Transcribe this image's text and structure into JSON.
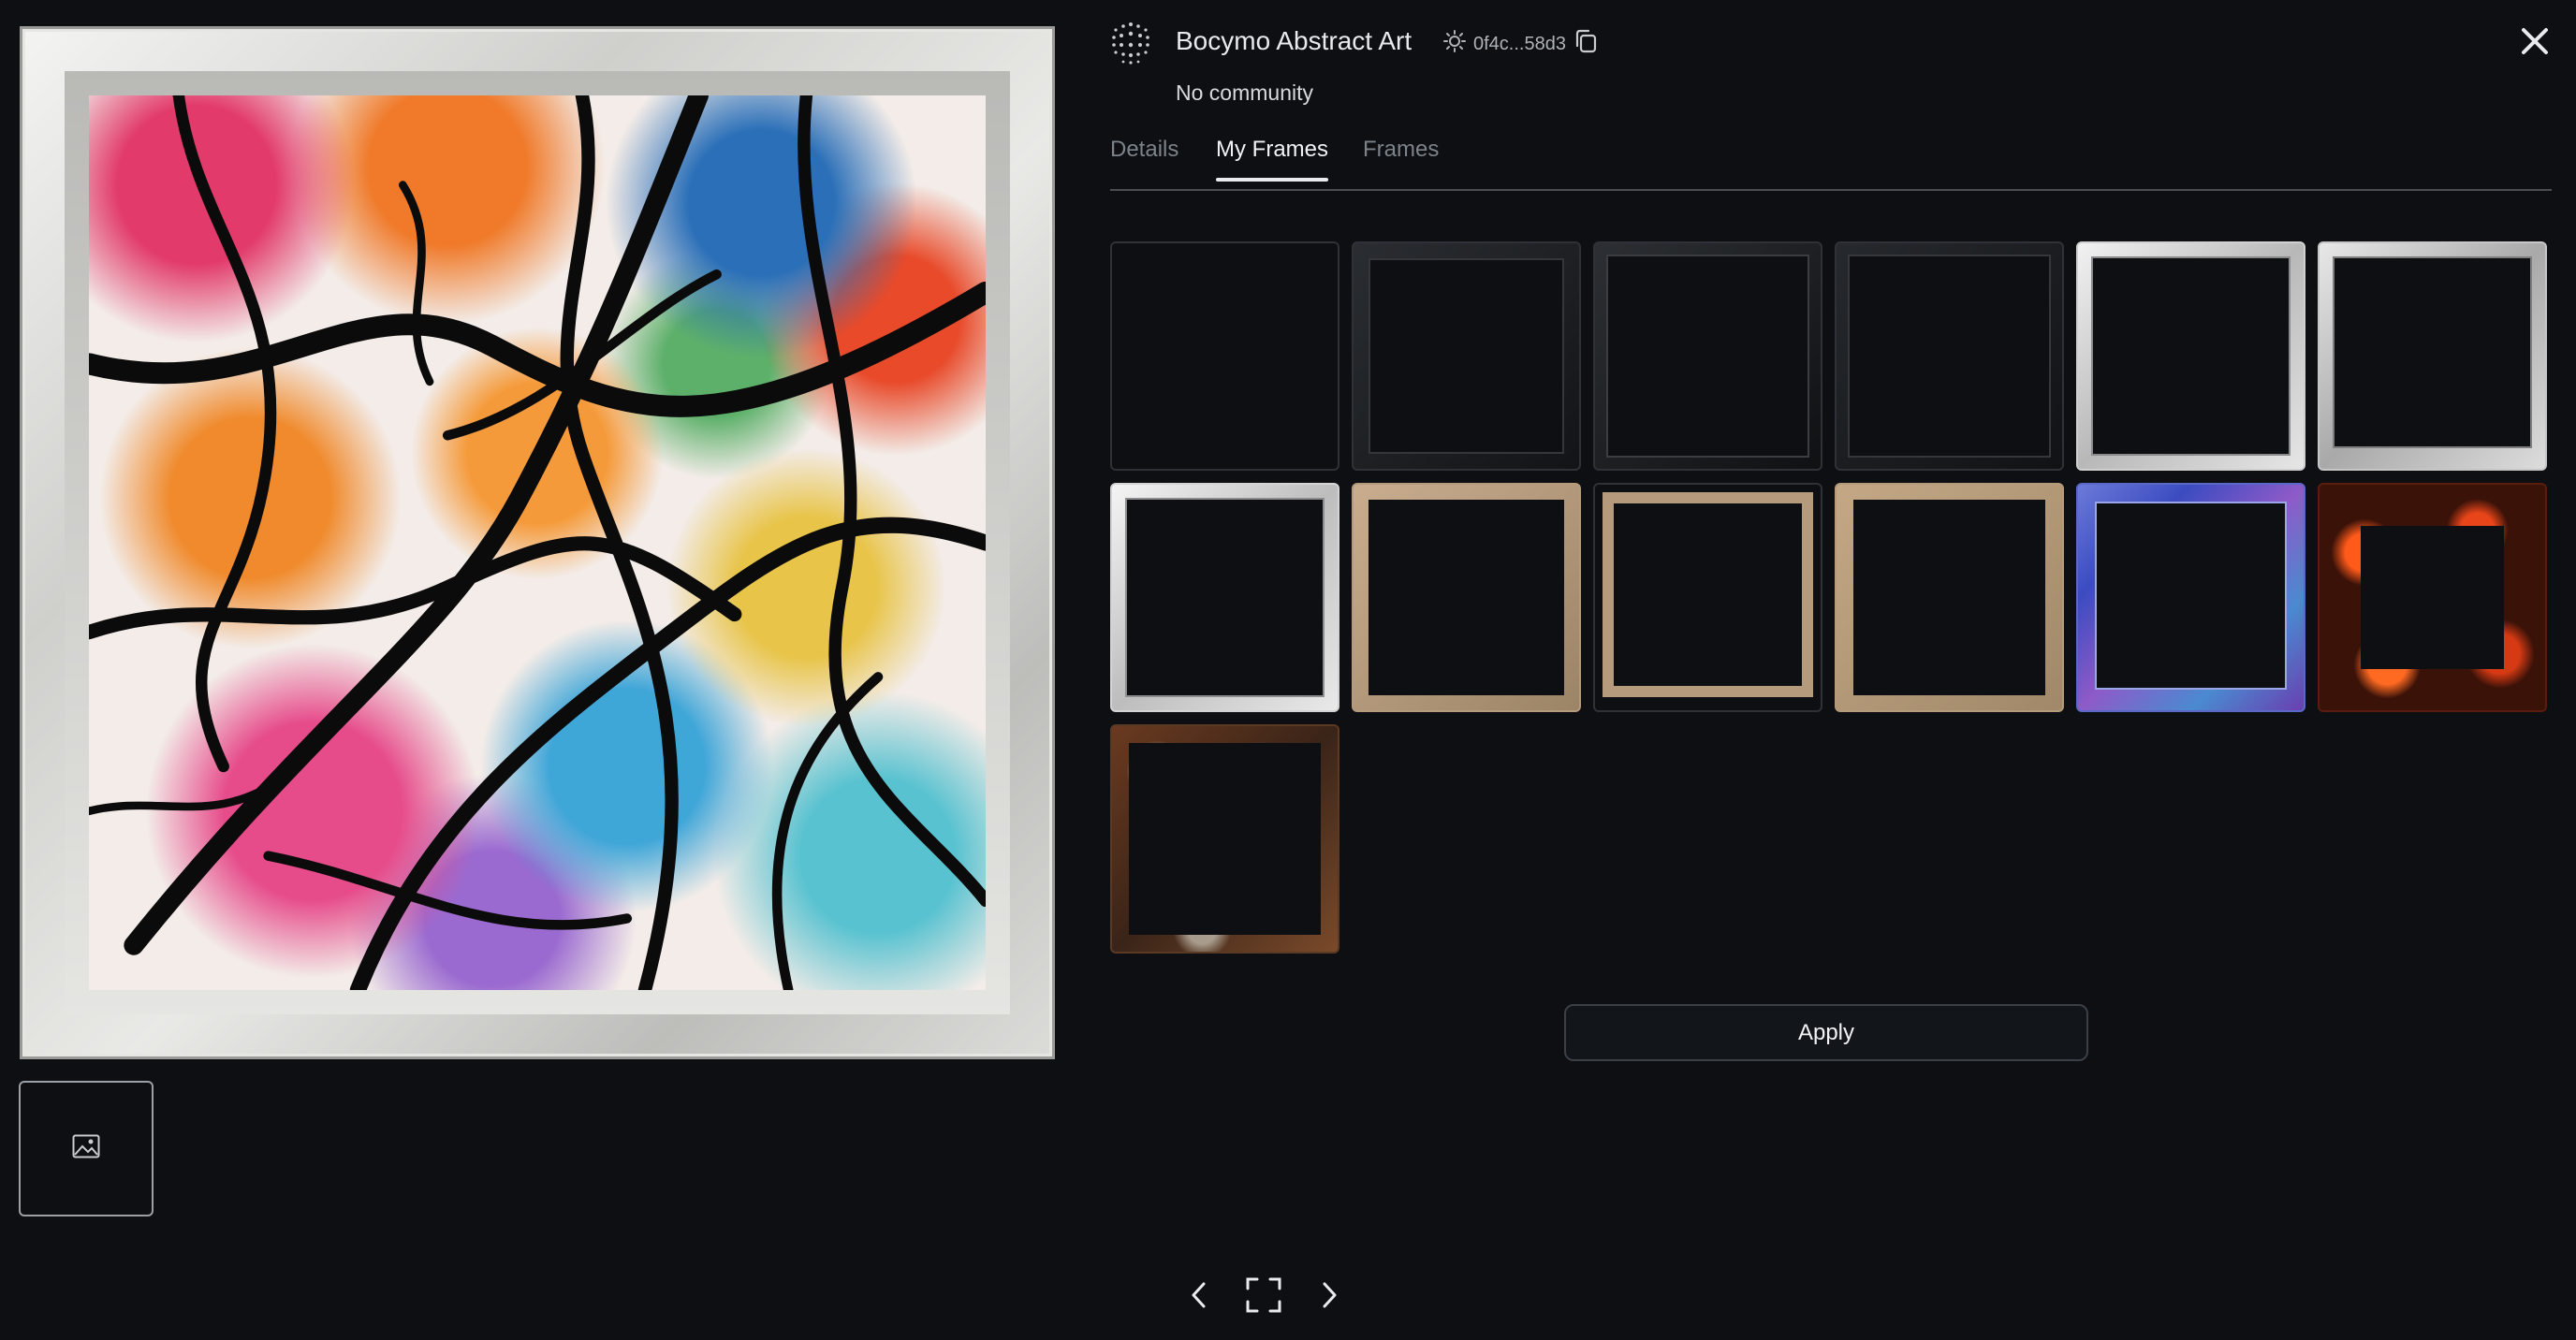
{
  "header": {
    "collection_title": "Bocymo Abstract Art",
    "address": "0f4c...58d3",
    "community": "No community"
  },
  "tabs": [
    {
      "label": "Details",
      "active": false
    },
    {
      "label": "My Frames",
      "active": true
    },
    {
      "label": "Frames",
      "active": false
    }
  ],
  "frames": [
    {
      "style": "none"
    },
    {
      "style": "black-bevel"
    },
    {
      "style": "black-bevel"
    },
    {
      "style": "black-bevel"
    },
    {
      "style": "silver"
    },
    {
      "style": "silver"
    },
    {
      "style": "silver-thin"
    },
    {
      "style": "tan-wood"
    },
    {
      "style": "tan-wood"
    },
    {
      "style": "tan-wood"
    },
    {
      "style": "iridescent"
    },
    {
      "style": "lava"
    },
    {
      "style": "rusty-metal"
    }
  ],
  "actions": {
    "apply_label": "Apply"
  },
  "colors": {
    "background": "#0d0f12",
    "text": "#e8eaed",
    "muted": "#7d838a"
  },
  "icons": [
    "dot-grid-logo-icon",
    "network-icon",
    "copy-icon",
    "close-icon",
    "image-icon",
    "chevron-left-icon",
    "fullscreen-icon",
    "chevron-right-icon"
  ]
}
